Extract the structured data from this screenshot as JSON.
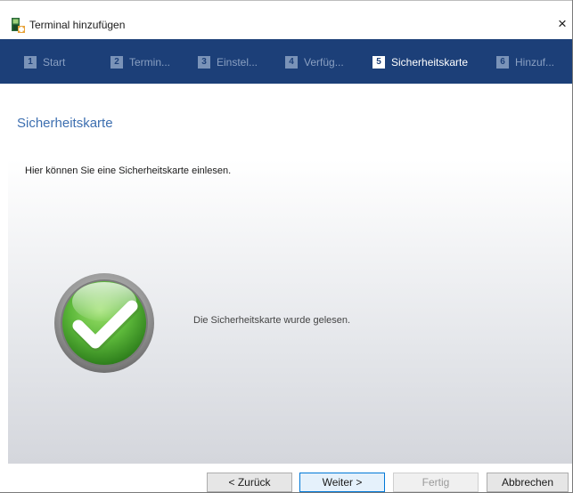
{
  "window": {
    "title": "Terminal hinzufügen",
    "close_label": "×"
  },
  "steps": [
    {
      "number": "1",
      "label": "Start",
      "active": false
    },
    {
      "number": "2",
      "label": "Termin...",
      "active": false
    },
    {
      "number": "3",
      "label": "Einstel...",
      "active": false
    },
    {
      "number": "4",
      "label": "Verfüg...",
      "active": false
    },
    {
      "number": "5",
      "label": "Sicherheitskarte",
      "active": true
    },
    {
      "number": "6",
      "label": "Hinzuf...",
      "active": false
    }
  ],
  "page": {
    "section_title": "Sicherheitskarte",
    "description": "Hier können Sie eine Sicherheitskarte einlesen.",
    "status_text": "Die Sicherheitskarte wurde gelesen.",
    "status_icon": "success-check-icon"
  },
  "buttons": {
    "back": "< Zurück",
    "next": "Weiter >",
    "finish": "Fertig",
    "cancel": "Abbrechen"
  },
  "colors": {
    "header_bg": "#1c3f78",
    "section_title": "#3d6fb0",
    "success_green": "#5cb83a"
  }
}
